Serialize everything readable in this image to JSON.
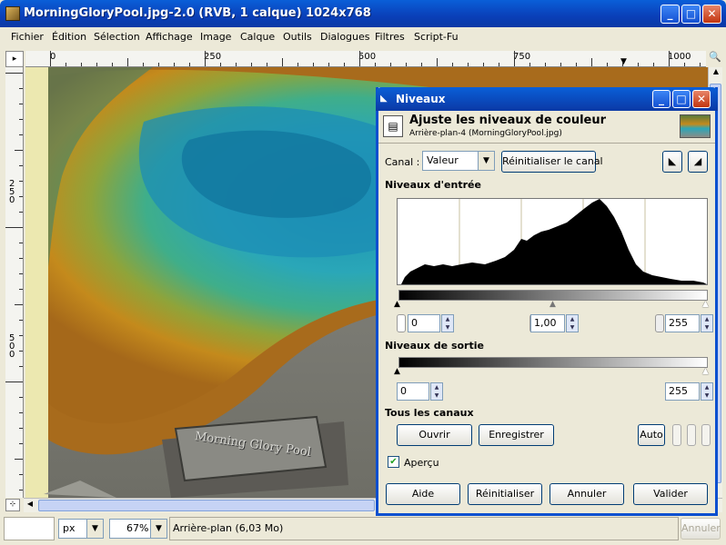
{
  "window": {
    "title": "MorningGloryPool.jpg-2.0 (RVB, 1 calque) 1024x768"
  },
  "menu": [
    "Fichier",
    "Édition",
    "Sélection",
    "Affichage",
    "Image",
    "Calque",
    "Outils",
    "Dialogues",
    "Filtres",
    "Script-Fu"
  ],
  "ruler": {
    "h_labels": [
      "0",
      "250",
      "500",
      "750",
      "1000"
    ],
    "v_labels": [
      "250",
      "500"
    ]
  },
  "sign_text": "Morning Glory Pool",
  "status": {
    "unit": "px",
    "zoom": "67%",
    "info": "Arrière-plan (6,03 Mo)",
    "cancel": "Annuler"
  },
  "dialog": {
    "title": "Niveaux",
    "heading": "Ajuste les niveaux de couleur",
    "subheading": "Arrière-plan-4 (MorningGloryPool.jpg)",
    "channel_label": "Canal :",
    "channel_value": "Valeur",
    "reset_channel": "Réinitialiser le canal",
    "input_levels": "Niveaux d'entrée",
    "input_low": "0",
    "input_gamma": "1,00",
    "input_high": "255",
    "output_levels": "Niveaux de sortie",
    "output_low": "0",
    "output_high": "255",
    "all_channels": "Tous les canaux",
    "open": "Ouvrir",
    "save": "Enregistrer",
    "auto": "Auto",
    "preview": "Aperçu",
    "help": "Aide",
    "reset": "Réinitialiser",
    "cancel": "Annuler",
    "ok": "Valider"
  },
  "colors": {
    "title_blue": "#0b4fd0",
    "close_red": "#d9431a",
    "pool_blue": "#3fa6b0",
    "pool_orange": "#c98a1e"
  }
}
